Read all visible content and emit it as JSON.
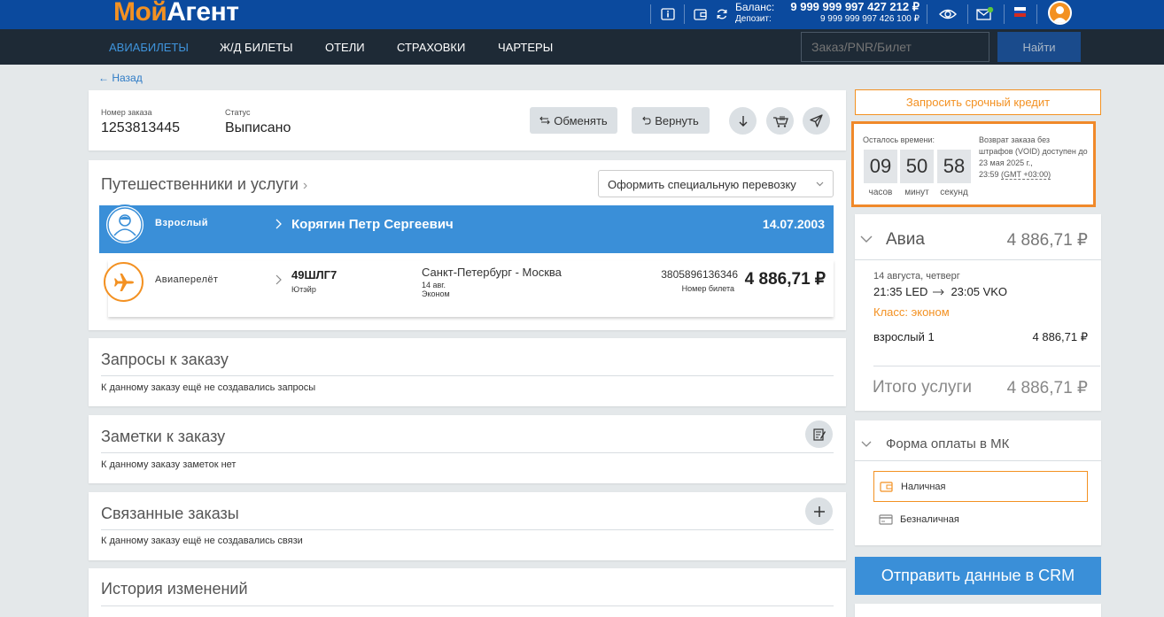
{
  "header": {
    "logo_part1": "Мой",
    "logo_part2": "Агент",
    "balance_label": "Баланс:",
    "balance_value": "9 999 999 997 427 212 ₽",
    "deposit_label": "Депозит:",
    "deposit_value": "9 999 999 997 426 100 ₽"
  },
  "nav": {
    "items": [
      "АВИАБИЛЕТЫ",
      "Ж/Д БИЛЕТЫ",
      "ОТЕЛИ",
      "СТРАХОВКИ",
      "ЧАРТЕРЫ"
    ],
    "search_placeholder": "Заказ/PNR/Билет",
    "search_button": "Найти"
  },
  "back": "← Назад",
  "order": {
    "number_label": "Номер заказа",
    "number": "1253813445",
    "status_label": "Статус",
    "status": "Выписано",
    "exchange_btn": "Обменять",
    "refund_btn": "Вернуть"
  },
  "travelers": {
    "title": "Путешественники и услуги",
    "special_dropdown": "Оформить специальную перевозку",
    "passenger": {
      "type": "Взрослый",
      "name": "Корягин Петр Сергеевич",
      "birth": "14.07.2003"
    },
    "flight": {
      "type": "Авиаперелёт",
      "pnr": "49ШЛГ7",
      "airline": "Ютэйр",
      "route": "Санкт-Петербург - Москва",
      "date": "14 авг.",
      "class": "Эконом",
      "ticket": "3805896136346",
      "ticket_label": "Номер билета",
      "price": "4 886,71 ₽"
    }
  },
  "requests": {
    "title": "Запросы к заказу",
    "empty": "К данному заказу ещё не создавались запросы"
  },
  "notes": {
    "title": "Заметки к заказу",
    "empty": "К данному заказу заметок нет"
  },
  "linked": {
    "title": "Связанные заказы",
    "empty": "К данному заказу ещё не создавались связи"
  },
  "history": {
    "title": "История изменений"
  },
  "sidebar": {
    "credit_btn": "Запросить срочный кредит",
    "timer": {
      "remaining_label": "Осталось времени:",
      "hours": "09",
      "minutes": "50",
      "seconds": "58",
      "hours_lbl": "часов",
      "minutes_lbl": "минут",
      "seconds_lbl": "секунд",
      "void_line1": "Возврат заказа без",
      "void_line2": "штрафов (VOID) доступен до",
      "void_line3": "23 мая 2025 г.,",
      "void_time": "23:59",
      "void_tz": "(GMT +03:00)"
    },
    "avia": {
      "title": "Авиа",
      "total": "4 886,71 ₽",
      "date": "14 августа, четверг",
      "dep": "21:35 LED",
      "arr": "23:05 VKO",
      "class": "Класс: эконом",
      "pax": "взрослый 1",
      "pax_price": "4 886,71 ₽",
      "services_label": "Итого услуги",
      "services_total": "4 886,71 ₽"
    },
    "payment": {
      "title": "Форма оплаты в МК",
      "cash": "Наличная",
      "noncash": "Безналичная"
    },
    "crm_btn": "Отправить данные в CRM"
  },
  "colors": {
    "brand_blue": "#0b4a9e",
    "nav_dark": "#1e2a36",
    "accent_orange": "#f39122",
    "row_blue": "#3a8fd8"
  }
}
